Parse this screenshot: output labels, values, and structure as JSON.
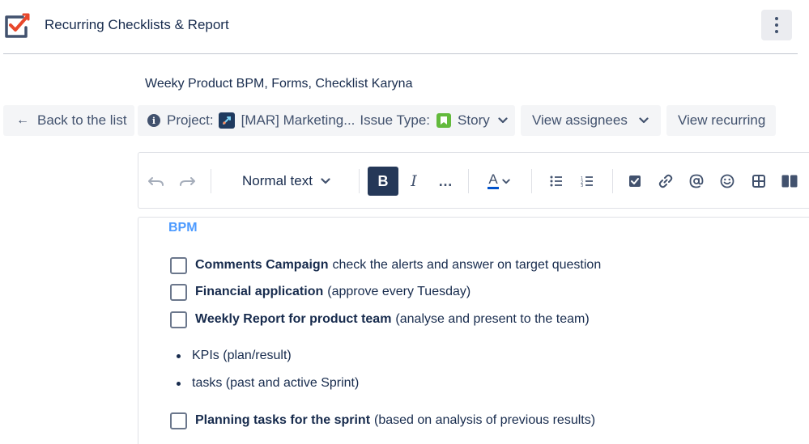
{
  "app": {
    "title": "Recurring Checklists & Report"
  },
  "checklist": {
    "title": "Weeky Product BPM, Forms, Checklist Karyna"
  },
  "toolbar": {
    "back_label": "Back to the list",
    "project_prefix": "Project:",
    "project_name": "[MAR] Marketing...",
    "issue_type_prefix": "Issue Type:",
    "issue_type": "Story",
    "assignees_label": "View assignees",
    "recurring_label": "View recurring"
  },
  "editor": {
    "text_style": "Normal text",
    "bold_label": "B",
    "italic_label": "I",
    "more_label": "…",
    "text_color_label": "A"
  },
  "content": {
    "heading": "BPM",
    "tasks": [
      {
        "bold": "Comments Campaign",
        "rest": "check the alerts and answer on target question"
      },
      {
        "bold": "Financial application",
        "rest": "(approve every Tuesday)"
      },
      {
        "bold": "Weekly Report for product team",
        "rest": "(analyse and present to the team)"
      },
      {
        "bold": "Planning tasks for the sprint",
        "rest": "(based on analysis of previous results)"
      }
    ],
    "bullets": [
      "KPIs (plan/result)",
      "tasks (past and active Sprint)"
    ]
  },
  "colors": {
    "accent": "#4C9AFF",
    "logo_orange": "#E8472B",
    "logo_slate": "#42526E",
    "story_green": "#63BA3C",
    "bold_active": "#253858"
  }
}
